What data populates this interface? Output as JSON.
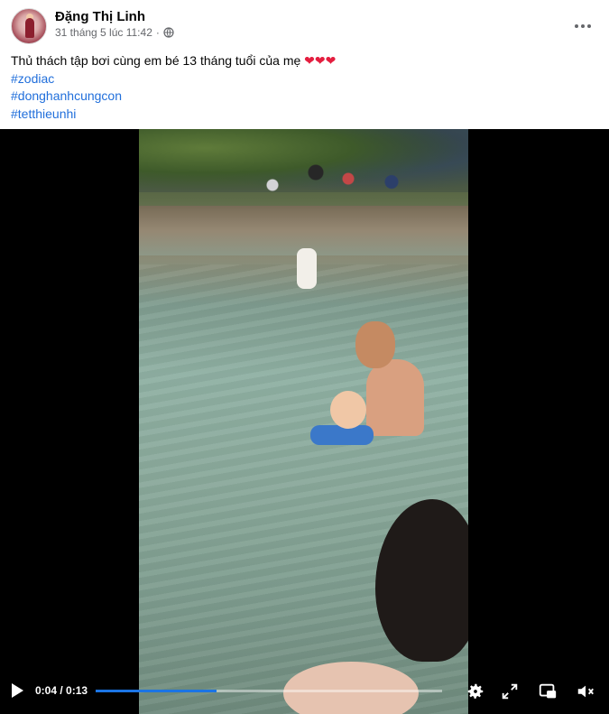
{
  "post": {
    "author": "Đặng Thị Linh",
    "timestamp": "31 tháng 5 lúc 11:42",
    "separator": "·",
    "privacy_icon": "globe-icon",
    "more_icon": "more-horizontal-icon",
    "caption": "Thủ thách tập bơi cùng em bé 13 tháng tuổi của mẹ",
    "hearts": "❤❤❤",
    "hashtags": [
      "#zodiac",
      "#donghanhcungcon",
      "#tetthieunhi"
    ]
  },
  "video": {
    "current_time": "0:04",
    "time_separator": " / ",
    "duration": "0:13",
    "progress_fraction": 0.35,
    "accent_color": "#1b74e4",
    "control_icons": [
      "play-icon",
      "settings-icon",
      "fullscreen-icon",
      "picture-in-picture-icon",
      "volume-muted-icon"
    ]
  }
}
